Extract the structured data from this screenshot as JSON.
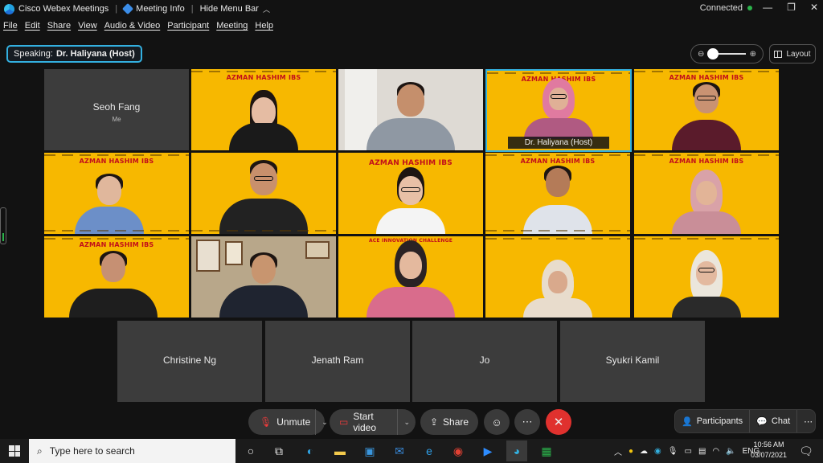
{
  "titlebar": {
    "app_name": "Cisco Webex Meetings",
    "meeting_info": "Meeting Info",
    "hide_menu": "Hide Menu Bar",
    "status": "Connected"
  },
  "menu": [
    "File",
    "Edit",
    "Share",
    "View",
    "Audio & Video",
    "Participant",
    "Meeting",
    "Help"
  ],
  "speaking": {
    "label": "Speaking:",
    "name": "Dr. Haliyana (Host)"
  },
  "layout_button": "Layout",
  "grid": {
    "self_tile": {
      "name": "Seoh Fang",
      "sub": "Me"
    },
    "banner_title": "AZMAN HASHIM",
    "banner_suffix": "IBS",
    "banner_alt": "ACE INNOVATION CHALLENGE",
    "host_label": "Dr. Haliyana  (Host)"
  },
  "bottom_tiles": [
    "Christine Ng",
    "Jenath Ram",
    "Jo",
    "Syukri Kamil"
  ],
  "controls": {
    "unmute": "Unmute",
    "start_video": "Start video",
    "share": "Share",
    "participants": "Participants",
    "chat": "Chat"
  },
  "taskbar": {
    "search_placeholder": "Type here to search",
    "lang": "ENG",
    "time": "10:56 AM",
    "date": "03/07/2021"
  },
  "colors": {
    "accent": "#33b0e0",
    "end_call": "#e0312e",
    "banner_yellow": "#f7b800",
    "banner_red": "#c20e1a"
  }
}
